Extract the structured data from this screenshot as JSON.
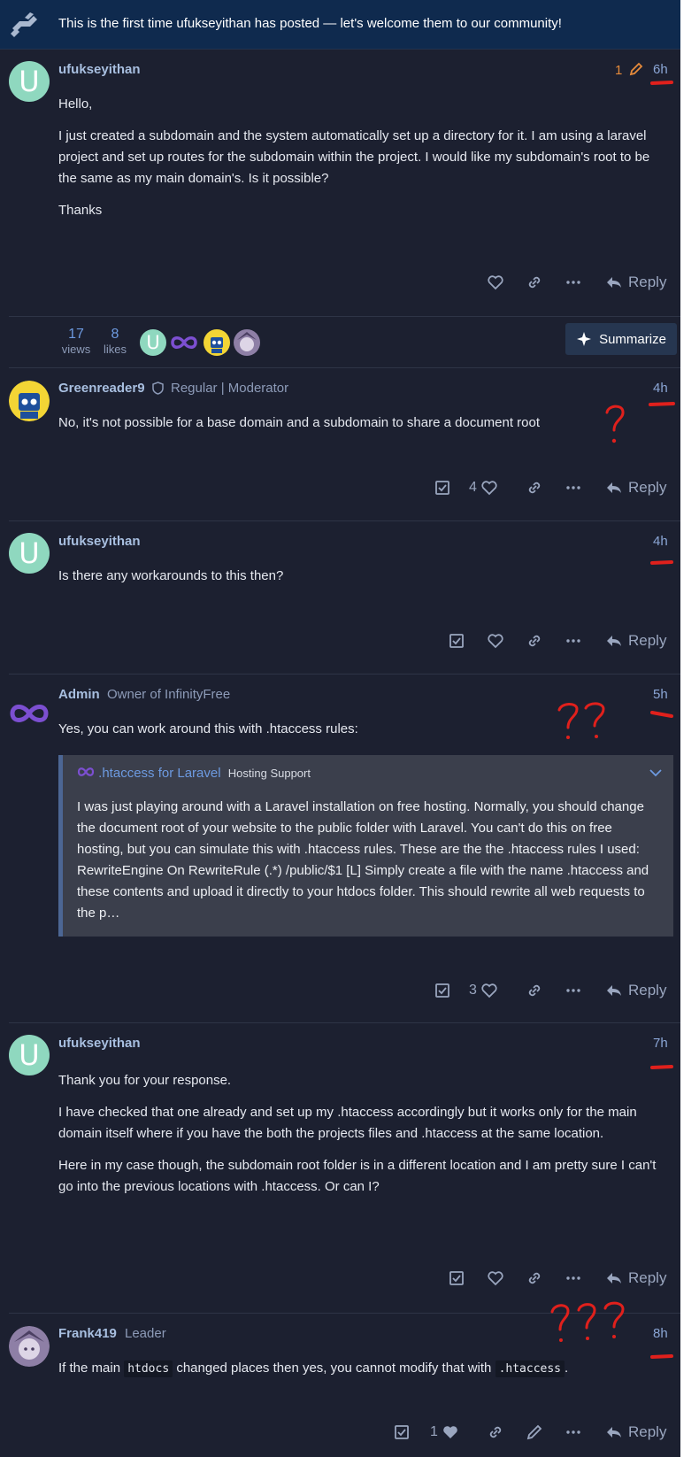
{
  "banner": {
    "text": "This is the first time ufukseyithan has posted — let's welcome them to our community!"
  },
  "posts": [
    {
      "username": "ufukseyithan",
      "avatar_letter": "U",
      "edits": "1",
      "age": "6h",
      "paragraphs": [
        "Hello,",
        "I just created a subdomain and the system automatically set up a directory for it. I am using a laravel project and set up routes for the subdomain within the project. I would like my subdomain's root to be the same as my main domain's. Is it possible?",
        "Thanks"
      ],
      "reply_label": "Reply"
    },
    {
      "username": "Greenreader9",
      "title": "Regular | Moderator",
      "age": "4h",
      "paragraphs": [
        "No, it's not possible for a base domain and a subdomain to share a document root"
      ],
      "like_count": "4",
      "reply_label": "Reply"
    },
    {
      "username": "ufukseyithan",
      "avatar_letter": "U",
      "age": "4h",
      "paragraphs": [
        "Is there any workarounds to this then?"
      ],
      "reply_label": "Reply"
    },
    {
      "username": "Admin",
      "title": "Owner of InfinityFree",
      "age": "5h",
      "paragraphs": [
        "Yes, you can work around this with .htaccess rules:"
      ],
      "quote": {
        "title": ".htaccess for Laravel",
        "category": "Hosting Support",
        "body": "I was just playing around with a Laravel installation on free hosting. Normally, you should change the document root of your website to the public folder with Laravel. You can't do this on free hosting, but you can simulate this with .htaccess rules. These are the the .htaccess rules I used: RewriteEngine On RewriteRule (.*) /public/$1 [L] Simply create a file with the name .htaccess and these contents and upload it directly to your htdocs folder. This should rewrite all web requests to the p…"
      },
      "like_count": "3",
      "reply_label": "Reply"
    },
    {
      "username": "ufukseyithan",
      "avatar_letter": "U",
      "age": "7h",
      "paragraphs": [
        "Thank you for your response.",
        "I have checked that one already and set up my .htaccess accordingly but it works only for the main domain itself where if you have the both the projects files and .htaccess at the same location.",
        "Here in my case though, the subdomain root folder is in a different location and I am pretty sure I can't go into the previous locations with .htaccess. Or can I?"
      ],
      "reply_label": "Reply"
    },
    {
      "username": "Frank419",
      "title": "Leader",
      "age": "8h",
      "text_before": "If the main ",
      "code1": "htdocs",
      "text_middle": " changed places then yes, you cannot modify that with ",
      "code2": ".htaccess",
      "text_after": ".",
      "like_count": "1",
      "reply_label": "Reply"
    }
  ],
  "topic_stats": {
    "views_count": "17",
    "views_label": "views",
    "likes_count": "8",
    "likes_label": "likes",
    "participant_letter": "U",
    "summarize_label": "Summarize"
  },
  "colors": {
    "accent": "#6d9ae0",
    "background": "#1c2030",
    "banner": "#0f2a4e",
    "edit": "#e58a3b",
    "annotation": "#e0201c"
  },
  "icons": [
    "heart-icon",
    "link-icon",
    "ellipsis-icon",
    "reply-icon",
    "solved-checkbox-icon",
    "pencil-icon",
    "sparkle-icon",
    "infinity-icon",
    "shield-icon"
  ]
}
